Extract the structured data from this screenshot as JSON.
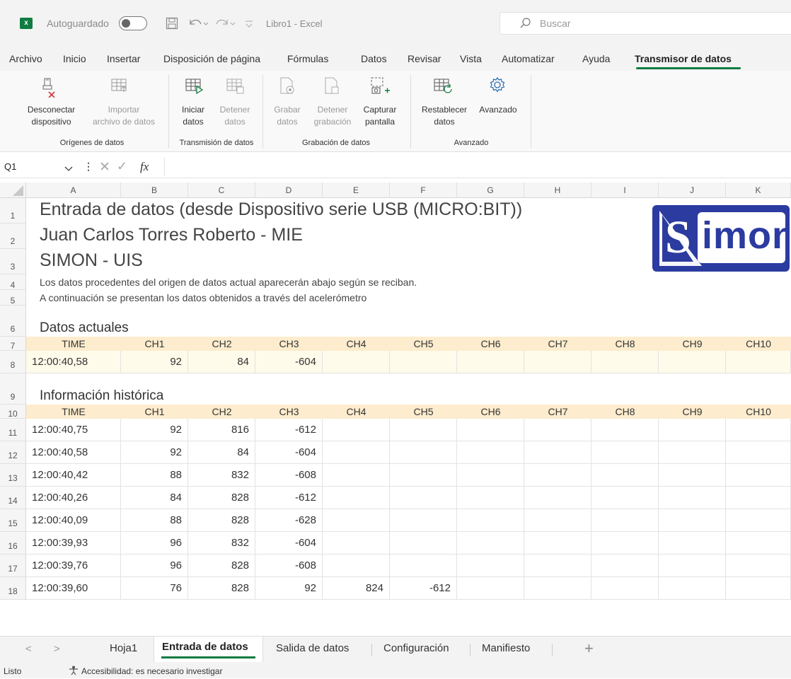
{
  "titlebar": {
    "autosave_label": "Autoguardado",
    "doc_title": "Libro1 - Excel",
    "search_placeholder": "Buscar"
  },
  "menu": [
    "Archivo",
    "Inicio",
    "Insertar",
    "Disposición de página",
    "Fórmulas",
    "Datos",
    "Revisar",
    "Vista",
    "Automatizar",
    "Ayuda",
    "Transmisor de datos"
  ],
  "ribbon": {
    "buttons": [
      {
        "line1": "Desconectar",
        "line2": "dispositivo"
      },
      {
        "line1": "Importar",
        "line2": "archivo de datos"
      },
      {
        "line1": "Iniciar",
        "line2": "datos"
      },
      {
        "line1": "Detener",
        "line2": "datos"
      },
      {
        "line1": "Grabar",
        "line2": "datos"
      },
      {
        "line1": "Detener",
        "line2": "grabación"
      },
      {
        "line1": "Capturar",
        "line2": "pantalla"
      },
      {
        "line1": "Restablecer",
        "line2": "datos"
      },
      {
        "line1": "Avanzado",
        "line2": ""
      }
    ],
    "groups": [
      "Orígenes de datos",
      "Transmisión de datos",
      "Grabación de datos",
      "Avanzado"
    ]
  },
  "formula": {
    "name_box": "Q1",
    "fx": "fx"
  },
  "columns": [
    "A",
    "B",
    "C",
    "D",
    "E",
    "F",
    "G",
    "H",
    "I",
    "J",
    "K"
  ],
  "rows": [
    "1",
    "2",
    "3",
    "4",
    "5",
    "6",
    "7",
    "8",
    "9",
    "10",
    "11",
    "12",
    "13",
    "14",
    "15",
    "16",
    "17",
    "18"
  ],
  "sheet": {
    "title1": "Entrada de datos (desde Dispositivo serie USB (MICRO:BIT))",
    "title2": "Juan Carlos Torres Roberto - MIE",
    "title3": "SIMON - UIS",
    "note1": "Los datos procedentes del origen de datos actual aparecerán abajo según se reciban.",
    "note2": "A continuación se presentan los datos obtenidos a través del acelerómetro",
    "current_heading": "Datos actuales",
    "history_heading": "Información histórica",
    "logo_text": "imon",
    "headers": [
      "TIME",
      "CH1",
      "CH2",
      "CH3",
      "CH4",
      "CH5",
      "CH6",
      "CH7",
      "CH8",
      "CH9",
      "CH10"
    ],
    "current_row": [
      "12:00:40,58",
      "92",
      "84",
      "-604",
      "",
      "",
      "",
      "",
      "",
      "",
      ""
    ],
    "history_rows": [
      [
        "12:00:40,75",
        "92",
        "816",
        "-612",
        "",
        ""
      ],
      [
        "12:00:40,58",
        "92",
        "84",
        "-604",
        "",
        ""
      ],
      [
        "12:00:40,42",
        "88",
        "832",
        "-608",
        "",
        ""
      ],
      [
        "12:00:40,26",
        "84",
        "828",
        "-612",
        "",
        ""
      ],
      [
        "12:00:40,09",
        "88",
        "828",
        "-628",
        "",
        ""
      ],
      [
        "12:00:39,93",
        "96",
        "832",
        "-604",
        "",
        ""
      ],
      [
        "12:00:39,76",
        "96",
        "828",
        "-608",
        "",
        ""
      ],
      [
        "12:00:39,60",
        "76",
        "828",
        "92",
        "824",
        "-612"
      ]
    ]
  },
  "tabs": [
    "Hoja1",
    "Entrada de datos",
    "Salida de datos",
    "Configuración",
    "Manifiesto"
  ],
  "status": {
    "ready": "Listo",
    "accessibility": "Accesibilidad: es necesario investigar"
  },
  "colors": {
    "accent": "#107c41",
    "header_band": "#fdeccd",
    "logo_blue": "#2b3ba0"
  }
}
